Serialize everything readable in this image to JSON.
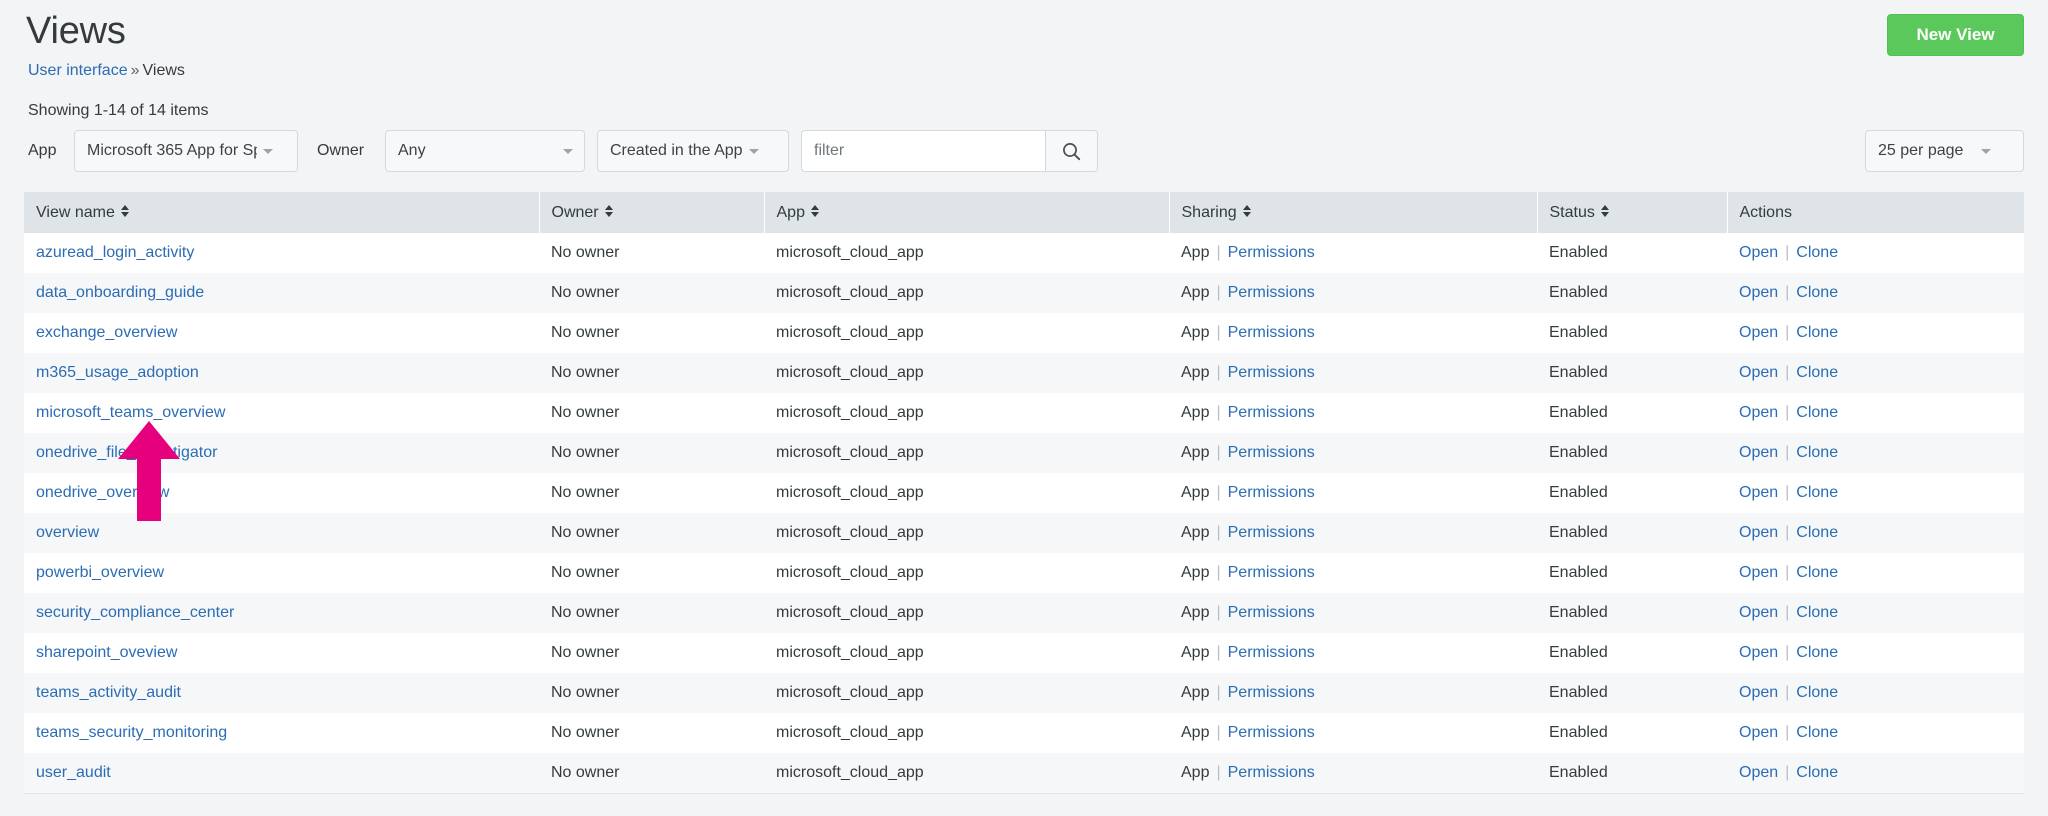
{
  "header": {
    "title": "Views",
    "breadcrumb": {
      "parent": "User interface",
      "separator": "»",
      "current": "Views"
    },
    "new_view_label": "New View",
    "accent_green": "#5bc85b",
    "link_blue": "#2b6cb4"
  },
  "summary": {
    "showing": "Showing 1-14 of 14 items"
  },
  "filters": {
    "app_label": "App",
    "app_value": "Microsoft 365 App for Sp",
    "owner_label": "Owner",
    "owner_value": "Any",
    "created_value": "Created in the App",
    "search_placeholder": "filter",
    "search_value": "",
    "search_icon": "search-icon",
    "per_page_value": "25 per page"
  },
  "table": {
    "columns": [
      {
        "label": "View name",
        "sortable": true
      },
      {
        "label": "Owner",
        "sortable": true
      },
      {
        "label": "App",
        "sortable": true
      },
      {
        "label": "Sharing",
        "sortable": true
      },
      {
        "label": "Status",
        "sortable": true
      },
      {
        "label": "Actions",
        "sortable": false
      }
    ],
    "sharing_scope_label": "App",
    "permissions_label": "Permissions",
    "open_label": "Open",
    "clone_label": "Clone",
    "separator": "|",
    "rows": [
      {
        "name": "azuread_login_activity",
        "owner": "No owner",
        "app": "microsoft_cloud_app",
        "status": "Enabled"
      },
      {
        "name": "data_onboarding_guide",
        "owner": "No owner",
        "app": "microsoft_cloud_app",
        "status": "Enabled"
      },
      {
        "name": "exchange_overview",
        "owner": "No owner",
        "app": "microsoft_cloud_app",
        "status": "Enabled"
      },
      {
        "name": "m365_usage_adoption",
        "owner": "No owner",
        "app": "microsoft_cloud_app",
        "status": "Enabled"
      },
      {
        "name": "microsoft_teams_overview",
        "owner": "No owner",
        "app": "microsoft_cloud_app",
        "status": "Enabled"
      },
      {
        "name": "onedrive_file_investigator",
        "owner": "No owner",
        "app": "microsoft_cloud_app",
        "status": "Enabled"
      },
      {
        "name": "onedrive_overview",
        "owner": "No owner",
        "app": "microsoft_cloud_app",
        "status": "Enabled"
      },
      {
        "name": "overview",
        "owner": "No owner",
        "app": "microsoft_cloud_app",
        "status": "Enabled"
      },
      {
        "name": "powerbi_overview",
        "owner": "No owner",
        "app": "microsoft_cloud_app",
        "status": "Enabled"
      },
      {
        "name": "security_compliance_center",
        "owner": "No owner",
        "app": "microsoft_cloud_app",
        "status": "Enabled"
      },
      {
        "name": "sharepoint_oveview",
        "owner": "No owner",
        "app": "microsoft_cloud_app",
        "status": "Enabled"
      },
      {
        "name": "teams_activity_audit",
        "owner": "No owner",
        "app": "microsoft_cloud_app",
        "status": "Enabled"
      },
      {
        "name": "teams_security_monitoring",
        "owner": "No owner",
        "app": "microsoft_cloud_app",
        "status": "Enabled"
      },
      {
        "name": "user_audit",
        "owner": "No owner",
        "app": "microsoft_cloud_app",
        "status": "Enabled"
      }
    ]
  },
  "annotation": {
    "arrow_color": "#E6007E",
    "points_at": "microsoft_teams_overview"
  }
}
